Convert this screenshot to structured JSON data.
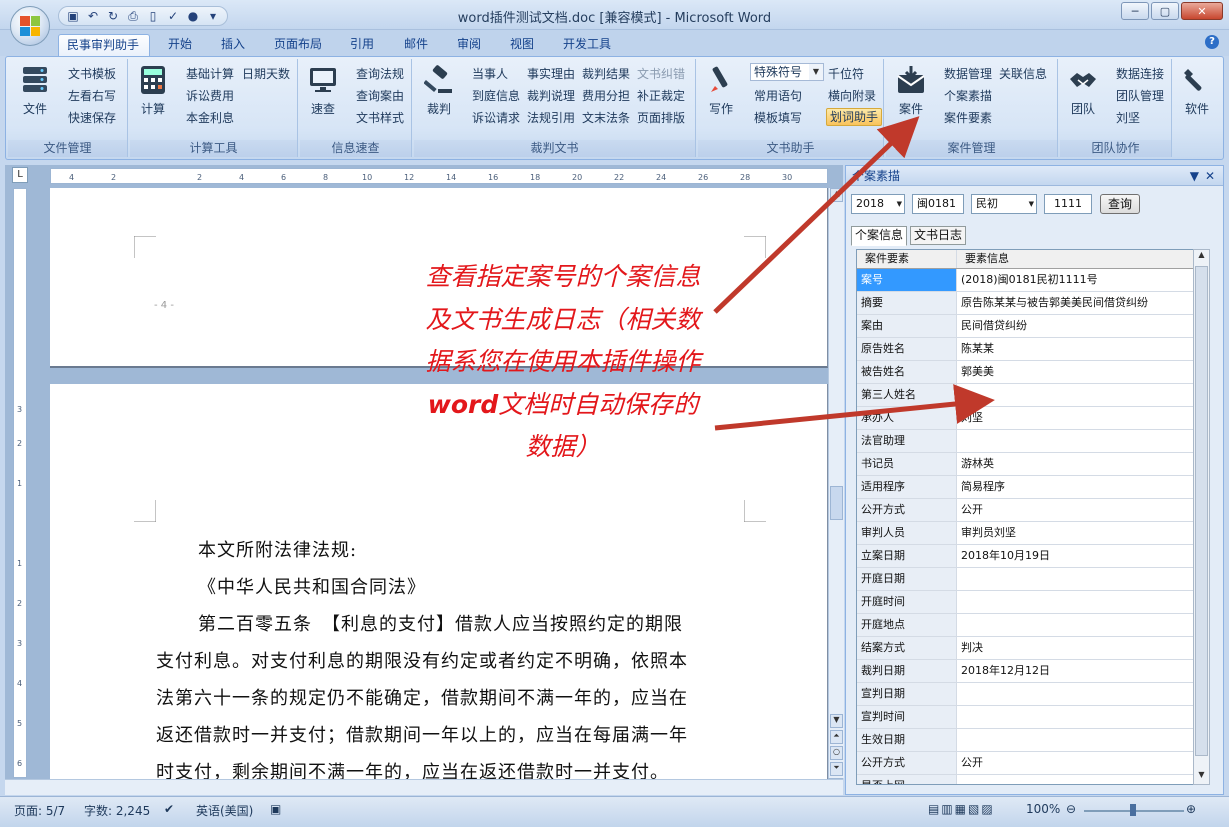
{
  "window": {
    "title": "word插件测试文档.doc [兼容模式] - Microsoft Word"
  },
  "quick_access": {
    "icons": [
      "save-icon",
      "undo-icon",
      "redo-icon",
      "print-preview-icon",
      "new-doc-icon",
      "spell-check-icon",
      "circle-icon",
      "more-icon"
    ]
  },
  "tabs": [
    "民事审判助手",
    "开始",
    "插入",
    "页面布局",
    "引用",
    "邮件",
    "审阅",
    "视图",
    "开发工具"
  ],
  "ribbon": {
    "file_group": {
      "label": "文件管理",
      "big": "文件",
      "items": [
        "文书模板",
        "左看右写",
        "快速保存"
      ]
    },
    "calc_group": {
      "label": "计算工具",
      "big": "计算",
      "items": [
        "基础计算",
        "诉讼费用",
        "本金利息",
        "日期天数"
      ]
    },
    "info_group": {
      "label": "信息速查",
      "big": "速查",
      "items": [
        "查询法规",
        "查询案由",
        "文书样式"
      ]
    },
    "judge_group": {
      "label": "裁判文书",
      "big": "裁判",
      "items": [
        "当事人",
        "到庭信息",
        "诉讼请求",
        "事实理由",
        "裁判说理",
        "法规引用",
        "裁判结果",
        "费用分担",
        "文末法条",
        "文书纠错",
        "补正裁定",
        "页面排版"
      ]
    },
    "writing_group": {
      "label": "文书助手",
      "big": "写作",
      "combo": "特殊符号",
      "items": [
        "常用语句",
        "模板填写",
        "千位符",
        "横向附录"
      ],
      "highlight": "划词助手"
    },
    "case_group": {
      "label": "案件管理",
      "big": "案件",
      "items": [
        "数据管理",
        "关联信息",
        "个案素描",
        "案件要素"
      ]
    },
    "team_group": {
      "label": "团队协作",
      "big": "团队",
      "items": [
        "数据连接",
        "团队管理",
        "刘坚"
      ]
    },
    "software_group": {
      "big": "软件"
    }
  },
  "document": {
    "page_number": "- 4 -",
    "lines": [
      "本文所附法律法规:",
      "《中华人民共和国合同法》",
      "第二百零五条　【利息的支付】借款人应当按照约定的期限",
      "支付利息。对支付利息的期限没有约定或者约定不明确，依照本",
      "法第六十一条的规定仍不能确定，借款期间不满一年的，应当在",
      "返还借款时一并支付；借款期间一年以上的，应当在每届满一年",
      "时支付，剩余期间不满一年的，应当在返还借款时一并支付。"
    ],
    "ruler_marks": [
      "4",
      "2",
      "2",
      "4",
      "6",
      "8",
      "10",
      "12",
      "14",
      "16",
      "18",
      "20",
      "22",
      "24",
      "26",
      "28",
      "30"
    ]
  },
  "annotation": {
    "text_parts": [
      "查看指定案号的个案信息及文书生成日志（相关数据系您在使用本插件操作",
      "word",
      "文档时自动保存的数据）"
    ],
    "color": "#e3171b"
  },
  "pane": {
    "title": "个案素描",
    "year": "2018",
    "court": "闽0181",
    "type": "民初",
    "number": "1111",
    "query_button": "查询",
    "tabs": [
      "个案信息",
      "文书日志"
    ],
    "columns": [
      "案件要素",
      "要素信息"
    ],
    "rows": [
      [
        "案号",
        "(2018)闽0181民初1111号"
      ],
      [
        "摘要",
        "原告陈某某与被告郭美美民间借贷纠纷"
      ],
      [
        "案由",
        "民间借贷纠纷"
      ],
      [
        "原告姓名",
        "陈某某"
      ],
      [
        "被告姓名",
        "郭美美"
      ],
      [
        "第三人姓名",
        ""
      ],
      [
        "承办人",
        "刘坚"
      ],
      [
        "法官助理",
        ""
      ],
      [
        "书记员",
        "游林英"
      ],
      [
        "适用程序",
        "简易程序"
      ],
      [
        "公开方式",
        "公开"
      ],
      [
        "审判人员",
        "审判员刘坚"
      ],
      [
        "立案日期",
        "2018年10月19日"
      ],
      [
        "开庭日期",
        ""
      ],
      [
        "开庭时间",
        ""
      ],
      [
        "开庭地点",
        ""
      ],
      [
        "结案方式",
        "判决"
      ],
      [
        "裁判日期",
        "2018年12月12日"
      ],
      [
        "宣判日期",
        ""
      ],
      [
        "宣判时间",
        ""
      ],
      [
        "生效日期",
        ""
      ],
      [
        "公开方式",
        "公开"
      ],
      [
        "是否上网",
        ""
      ]
    ]
  },
  "status": {
    "page": "页面: 5/7",
    "words": "字数: 2,245",
    "language": "英语(美国)",
    "zoom": "100%"
  }
}
